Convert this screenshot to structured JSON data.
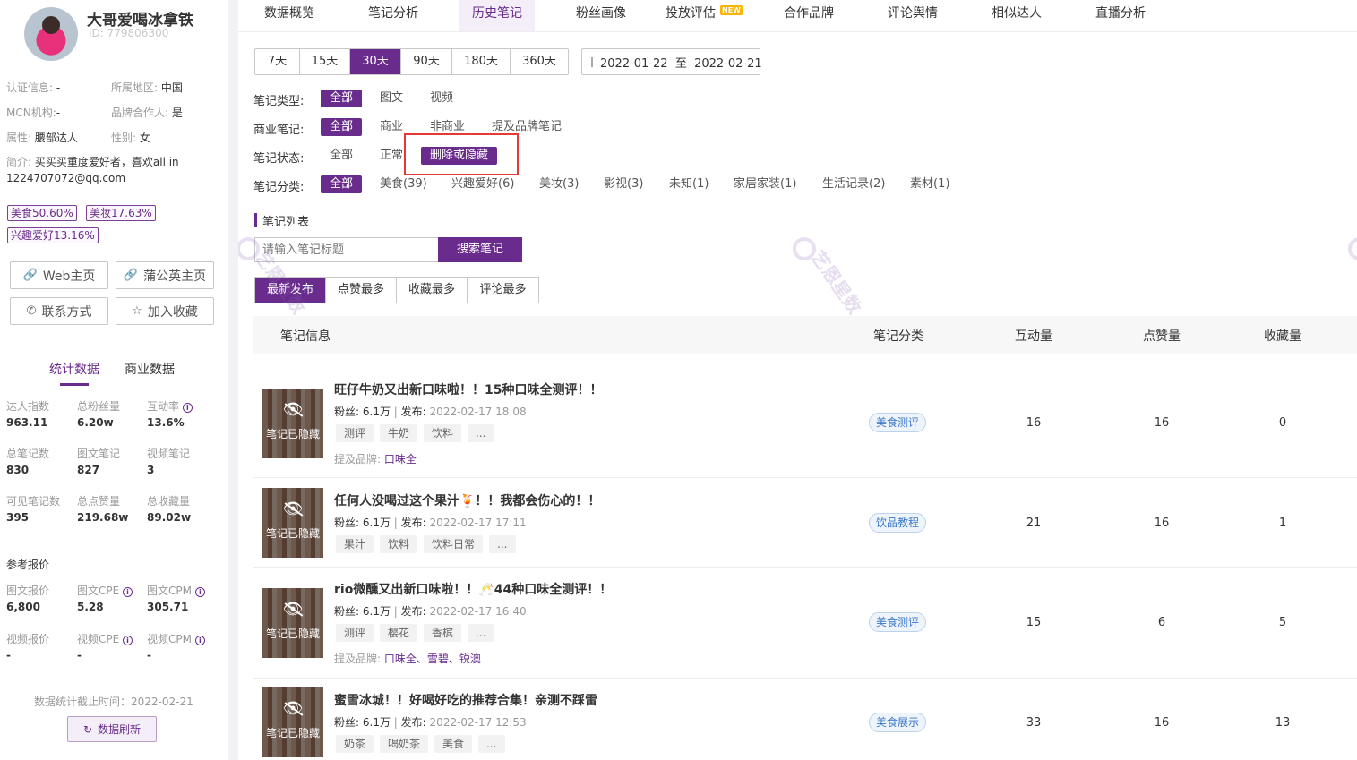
{
  "profile": {
    "name": "大哥爱喝冰拿铁",
    "id_text": "ID: 779806300",
    "info": [
      {
        "label": "认证信息:",
        "value": "-"
      },
      {
        "label": "所属地区:",
        "value": "中国"
      },
      {
        "label": "MCN机构:",
        "value": "-"
      },
      {
        "label": "品牌合作人:",
        "value": "是"
      },
      {
        "label": "属性:",
        "value": "腰部达人"
      },
      {
        "label": "性别:",
        "value": "女"
      }
    ],
    "intro_label": "简介:",
    "intro_text": "买买买重度爱好者，喜欢all in 1224707072@qq.com",
    "tags": [
      "美食50.60%",
      "美妆17.63%",
      "兴趣爱好13.16%"
    ],
    "buttons": {
      "web": "Web主页",
      "pgy": "蒲公英主页",
      "contact": "联系方式",
      "favorite": "加入收藏"
    },
    "stat_tabs": [
      "统计数据",
      "商业数据"
    ],
    "stats": [
      {
        "label": "达人指数",
        "value": "963.11"
      },
      {
        "label": "总粉丝量",
        "value": "6.20w"
      },
      {
        "label": "互动率",
        "value": "13.6%"
      },
      {
        "label": "总笔记数",
        "value": "830"
      },
      {
        "label": "图文笔记",
        "value": "827"
      },
      {
        "label": "视频笔记",
        "value": "3"
      },
      {
        "label": "可见笔记数",
        "value": "395"
      },
      {
        "label": "总点赞量",
        "value": "219.68w"
      },
      {
        "label": "总收藏量",
        "value": "89.02w"
      }
    ],
    "price_title": "参考报价",
    "prices": [
      {
        "label": "图文报价",
        "value": "6,800"
      },
      {
        "label": "图文CPE",
        "value": "5.28"
      },
      {
        "label": "图文CPM",
        "value": "305.71"
      },
      {
        "label": "视频报价",
        "value": "-"
      },
      {
        "label": "视频CPE",
        "value": "-"
      },
      {
        "label": "视频CPM",
        "value": "-"
      }
    ],
    "update_text": "数据统计截止时间：2022-02-21",
    "refresh_label": "数据刷新"
  },
  "nav": {
    "tabs": [
      "数据概览",
      "笔记分析",
      "历史笔记",
      "粉丝画像",
      "投放评估",
      "合作品牌",
      "评论舆情",
      "相似达人",
      "直播分析"
    ],
    "active": "历史笔记",
    "new_badge": "NEW"
  },
  "date": {
    "ranges": [
      "7天",
      "15天",
      "30天",
      "90天",
      "180天",
      "360天"
    ],
    "active": "30天",
    "range_text": "2022-01-22  至  2022-02-21"
  },
  "filters": [
    {
      "label": "笔记类型:",
      "options": [
        "全部",
        "图文",
        "视频"
      ]
    },
    {
      "label": "商业笔记:",
      "options": [
        "全部",
        "商业",
        "非商业",
        "提及品牌笔记"
      ]
    },
    {
      "label": "笔记状态:",
      "options": [
        "全部",
        "正常",
        "删除或隐藏"
      ]
    },
    {
      "label": "笔记分类:",
      "options": [
        "全部",
        "美食(39)",
        "兴趣爱好(6)",
        "美妆(3)",
        "影视(3)",
        "未知(1)",
        "家居家装(1)",
        "生活记录(2)",
        "素材(1)"
      ]
    }
  ],
  "list": {
    "section_title": "笔记列表",
    "search_placeholder": "请输入笔记标题",
    "search_button": "搜索笔记",
    "sort_options": [
      "最新发布",
      "点赞最多",
      "收藏最多",
      "评论最多"
    ],
    "columns": [
      "笔记信息",
      "笔记分类",
      "互动量",
      "点赞量",
      "收藏量"
    ],
    "hidden_label": "笔记已隐藏",
    "fans_label": "粉丝:",
    "publish_label": "发布:",
    "brand_label": "提及品牌:",
    "notes": [
      {
        "title": "旺仔牛奶又出新口味啦！！15种口味全测评！！",
        "fans": "6.1万",
        "date": "2022-02-17 18:08",
        "tags": [
          "测评",
          "牛奶",
          "饮料",
          "..."
        ],
        "brands": "口味全",
        "category": "美食测评",
        "interaction": "16",
        "likes": "16",
        "collects": "0"
      },
      {
        "title": "任何人没喝过这个果汁🍹！！我都会伤心的！！",
        "fans": "6.1万",
        "date": "2022-02-17 17:11",
        "tags": [
          "果汁",
          "饮料",
          "饮料日常",
          "..."
        ],
        "brands": "",
        "category": "饮品教程",
        "interaction": "21",
        "likes": "16",
        "collects": "1"
      },
      {
        "title": "rio微醺又出新口味啦！！🥂44种口味全测评！！",
        "fans": "6.1万",
        "date": "2022-02-17 16:40",
        "tags": [
          "测评",
          "樱花",
          "香槟",
          "..."
        ],
        "brands": "口味全、雪碧、锐澳",
        "category": "美食测评",
        "interaction": "15",
        "likes": "6",
        "collects": "5"
      },
      {
        "title": "蜜雪冰城！！好喝好吃的推荐合集！亲测不踩雷",
        "fans": "6.1万",
        "date": "2022-02-17 12:53",
        "tags": [
          "奶茶",
          "喝奶茶",
          "美食",
          "..."
        ],
        "brands": "",
        "category": "美食展示",
        "interaction": "33",
        "likes": "16",
        "collects": "13"
      }
    ]
  },
  "watermark": "艺恩星数",
  "colors": {
    "accent": "#6a2c8c",
    "highlight_box": "#e53935",
    "category_blue": "#3c78c8"
  }
}
